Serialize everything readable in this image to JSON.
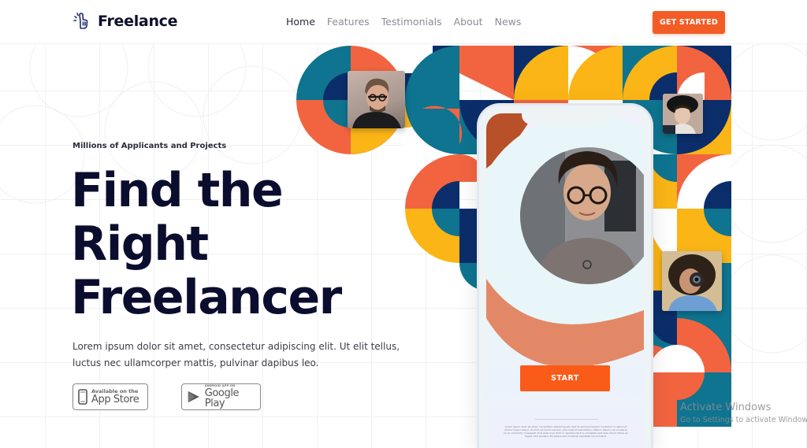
{
  "header": {
    "brand": "Freelance",
    "brand_icon": "hand-pointing-up-icon",
    "nav": [
      {
        "label": "Home",
        "active": true
      },
      {
        "label": "Features",
        "active": false
      },
      {
        "label": "Testimonials",
        "active": false
      },
      {
        "label": "About",
        "active": false
      },
      {
        "label": "News",
        "active": false
      }
    ],
    "cta_label": "GET STARTED"
  },
  "hero": {
    "eyebrow": "Millions of Applicants and Projects",
    "title_lines": [
      "Find the",
      "Right",
      "Freelancer"
    ],
    "description": "Lorem ipsum dolor sit amet, consectetur adipiscing elit. Ut elit tellus, luctus nec ullamcorper mattis, pulvinar dapibus leo.",
    "app_store": {
      "small": "Available on the",
      "big": "App Store",
      "icon": "phone-icon"
    },
    "google_play": {
      "small": "ANDROID APP ON",
      "big": "Google Play",
      "icon": "play-triangle-icon"
    }
  },
  "phone": {
    "button_label": "START",
    "fine_print": "Lorem ipsum dolor sit amet, consectetur adipiscing elit. Sed do eiusmod tempor incididunt ut labore et dolore magna aliqua. Ut enim ad minim veniam, quis nostrud exercitation ullamco laboris nisi ut aliquip ex ea commodo consequat. Duis aute irure dolor in reprehenderit in voluptate velit esse cillum dolore eu fugiat nulla pariatur. Excepteur sint occaecat cupidatat non proident."
  },
  "colors": {
    "accent": "#f45c25",
    "navy": "#0b2e6b",
    "teal": "#0e7490",
    "orange": "#f26440",
    "yellow": "#fbb516",
    "text_dark": "#0b0d2e"
  },
  "watermark": {
    "title": "Activate Windows",
    "subtitle": "Go to Settings to activate Windows."
  }
}
